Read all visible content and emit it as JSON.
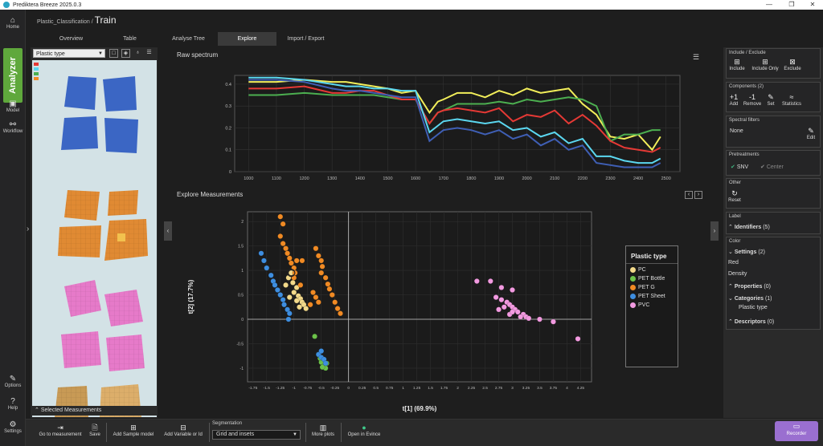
{
  "window": {
    "title": "Prediktera Breeze 2025.0.3",
    "controls": [
      "—",
      "❐",
      "✕"
    ]
  },
  "rail": {
    "home": "Home",
    "analyzer": "Analyzer",
    "model": "Model",
    "workflow": "Workflow",
    "options": "Options",
    "help": "Help",
    "settings": "Settings"
  },
  "breadcrumb": {
    "project": "Plastic_Classification /",
    "page": "Train"
  },
  "tabs": [
    "Overview",
    "Table",
    "Analyse Tree",
    "Explore",
    "Import / Export"
  ],
  "image_panel": {
    "select_value": "Plastic type",
    "selected_measurements": "Selected Measurements"
  },
  "spectrum": {
    "title": "Raw spectrum",
    "chart_data": {
      "type": "line",
      "title": "Raw spectrum",
      "xlabel": "",
      "ylabel": "",
      "xlim": [
        950,
        2550
      ],
      "ylim": [
        0,
        0.44
      ],
      "xticks": [
        1000,
        1100,
        1200,
        1300,
        1400,
        1500,
        1600,
        1700,
        1800,
        1900,
        2000,
        2100,
        2200,
        2300,
        2400,
        2500
      ],
      "yticks": [
        0,
        0.1,
        0.2,
        0.3,
        0.4
      ],
      "x": [
        1000,
        1100,
        1200,
        1300,
        1350,
        1400,
        1450,
        1500,
        1550,
        1600,
        1650,
        1680,
        1700,
        1750,
        1800,
        1850,
        1900,
        1950,
        2000,
        2050,
        2100,
        2150,
        2200,
        2250,
        2300,
        2350,
        2400,
        2450,
        2480
      ],
      "series": [
        {
          "color": "#f2ee5a",
          "values": [
            0.41,
            0.41,
            0.42,
            0.41,
            0.41,
            0.4,
            0.39,
            0.38,
            0.36,
            0.37,
            0.27,
            0.32,
            0.33,
            0.36,
            0.36,
            0.34,
            0.37,
            0.35,
            0.38,
            0.36,
            0.37,
            0.38,
            0.31,
            0.26,
            0.16,
            0.15,
            0.17,
            0.1,
            0.16
          ]
        },
        {
          "color": "#4caf50",
          "values": [
            0.35,
            0.35,
            0.36,
            0.35,
            0.35,
            0.35,
            0.35,
            0.34,
            0.33,
            0.33,
            0.22,
            0.27,
            0.28,
            0.31,
            0.31,
            0.31,
            0.32,
            0.31,
            0.33,
            0.32,
            0.33,
            0.34,
            0.33,
            0.3,
            0.14,
            0.17,
            0.17,
            0.19,
            0.19
          ]
        },
        {
          "color": "#e53935",
          "values": [
            0.38,
            0.38,
            0.39,
            0.36,
            0.36,
            0.37,
            0.37,
            0.35,
            0.33,
            0.33,
            0.22,
            0.27,
            0.28,
            0.29,
            0.28,
            0.27,
            0.29,
            0.23,
            0.26,
            0.25,
            0.28,
            0.22,
            0.26,
            0.21,
            0.14,
            0.11,
            0.1,
            0.09,
            0.11
          ]
        },
        {
          "color": "#5bd7f0",
          "values": [
            0.43,
            0.43,
            0.42,
            0.4,
            0.39,
            0.39,
            0.38,
            0.38,
            0.37,
            0.37,
            0.18,
            0.21,
            0.23,
            0.24,
            0.23,
            0.22,
            0.23,
            0.19,
            0.2,
            0.16,
            0.18,
            0.13,
            0.15,
            0.07,
            0.07,
            0.05,
            0.04,
            0.04,
            0.06
          ]
        },
        {
          "color": "#3f5fb5",
          "values": [
            0.42,
            0.42,
            0.41,
            0.38,
            0.37,
            0.37,
            0.36,
            0.35,
            0.34,
            0.34,
            0.14,
            0.17,
            0.19,
            0.2,
            0.19,
            0.17,
            0.19,
            0.15,
            0.17,
            0.12,
            0.15,
            0.1,
            0.12,
            0.04,
            0.03,
            0.02,
            0.02,
            0.02,
            0.04
          ]
        }
      ]
    }
  },
  "explore": {
    "title": "Explore Measurements",
    "chart_data": {
      "type": "scatter",
      "xlabel": "t[1] (69.9%)",
      "ylabel": "t[2] (17.7%)",
      "xlim": [
        -1.85,
        4.45
      ],
      "ylim": [
        -1.28,
        2.2
      ],
      "xticks": [
        -1.75,
        -1.5,
        -1.25,
        -1,
        -0.75,
        -0.5,
        -0.25,
        0,
        0.25,
        0.5,
        0.75,
        1,
        1.25,
        1.5,
        1.75,
        2,
        2.25,
        2.5,
        2.75,
        3,
        3.25,
        3.5,
        3.75,
        4,
        4.25
      ],
      "xticklabels": [
        "-1.75",
        "-1.5",
        "-1.25",
        "-1",
        "-0.75",
        "-0.5",
        "-0.25",
        "0",
        "0.25",
        "0.5",
        "0.75",
        "1",
        "1.25",
        "1.5",
        "1.75",
        "2",
        "2.25",
        "2.5",
        "2.75",
        "3",
        "3.25",
        "3.5",
        "3.75",
        "4",
        "4.25"
      ],
      "yticks": [
        -1,
        -0.5,
        0,
        0.5,
        1,
        1.5,
        2
      ],
      "yticklabels": [
        "-1",
        "-0.5",
        "0",
        "0.5",
        "1",
        "1.5",
        "2"
      ],
      "series": [
        {
          "name": "PC",
          "color": "#f2d98a",
          "points": [
            [
              -1.05,
              0.95
            ],
            [
              -1.1,
              0.85
            ],
            [
              -1.02,
              0.75
            ],
            [
              -0.95,
              0.65
            ],
            [
              -1.0,
              0.55
            ],
            [
              -0.92,
              0.48
            ],
            [
              -0.88,
              0.42
            ],
            [
              -0.85,
              0.35
            ],
            [
              -0.82,
              0.3
            ],
            [
              -0.9,
              0.25
            ],
            [
              -0.78,
              0.22
            ],
            [
              -1.15,
              0.7
            ],
            [
              -1.08,
              0.45
            ],
            [
              -0.95,
              0.38
            ]
          ]
        },
        {
          "name": "PET Bottle",
          "color": "#6cc24a",
          "points": [
            [
              -0.62,
              -0.35
            ],
            [
              -0.55,
              -0.72
            ],
            [
              -0.5,
              -0.88
            ],
            [
              -0.45,
              -0.95
            ],
            [
              -0.52,
              -0.8
            ],
            [
              -0.4,
              -0.9
            ],
            [
              -0.42,
              -1.0
            ],
            [
              -0.48,
              -0.98
            ]
          ]
        },
        {
          "name": "PET G",
          "color": "#f08a24",
          "points": [
            [
              -1.25,
              2.1
            ],
            [
              -1.2,
              1.95
            ],
            [
              -1.25,
              1.7
            ],
            [
              -1.2,
              1.55
            ],
            [
              -1.15,
              1.45
            ],
            [
              -1.12,
              1.35
            ],
            [
              -1.08,
              1.25
            ],
            [
              -1.05,
              1.15
            ],
            [
              -1.0,
              1.05
            ],
            [
              -0.98,
              0.95
            ],
            [
              -0.95,
              1.2
            ],
            [
              -0.85,
              1.2
            ],
            [
              -0.6,
              1.45
            ],
            [
              -0.55,
              1.3
            ],
            [
              -0.5,
              1.2
            ],
            [
              -0.48,
              1.08
            ],
            [
              -0.5,
              0.95
            ],
            [
              -0.42,
              0.85
            ],
            [
              -0.38,
              0.72
            ],
            [
              -0.35,
              0.62
            ],
            [
              -0.3,
              0.5
            ],
            [
              -0.25,
              0.35
            ],
            [
              -0.2,
              0.22
            ],
            [
              -0.15,
              0.12
            ],
            [
              -0.65,
              0.55
            ],
            [
              -0.6,
              0.45
            ],
            [
              -0.55,
              0.35
            ],
            [
              -0.7,
              0.3
            ],
            [
              -0.88,
              0.7
            ],
            [
              -1.0,
              0.85
            ]
          ]
        },
        {
          "name": "PET Sheet",
          "color": "#3e8ee0",
          "points": [
            [
              -1.6,
              1.35
            ],
            [
              -1.55,
              1.2
            ],
            [
              -1.5,
              1.05
            ],
            [
              -1.42,
              0.9
            ],
            [
              -1.38,
              0.78
            ],
            [
              -1.35,
              0.7
            ],
            [
              -1.3,
              0.6
            ],
            [
              -1.25,
              0.5
            ],
            [
              -1.2,
              0.4
            ],
            [
              -1.18,
              0.3
            ],
            [
              -1.12,
              0.2
            ],
            [
              -1.08,
              0.12
            ],
            [
              -1.1,
              0.0
            ],
            [
              -0.55,
              -0.72
            ],
            [
              -0.5,
              -0.78
            ],
            [
              -0.45,
              -0.82
            ],
            [
              -0.42,
              -0.9
            ],
            [
              -0.5,
              -0.65
            ]
          ]
        },
        {
          "name": "PVC",
          "color": "#f29ae0",
          "points": [
            [
              2.35,
              0.78
            ],
            [
              2.6,
              0.78
            ],
            [
              2.8,
              0.65
            ],
            [
              3.0,
              0.6
            ],
            [
              2.7,
              0.45
            ],
            [
              2.8,
              0.4
            ],
            [
              2.9,
              0.35
            ],
            [
              2.95,
              0.3
            ],
            [
              3.0,
              0.25
            ],
            [
              3.05,
              0.2
            ],
            [
              3.1,
              0.15
            ],
            [
              2.85,
              0.25
            ],
            [
              3.2,
              0.1
            ],
            [
              3.25,
              0.05
            ],
            [
              3.3,
              0.02
            ],
            [
              3.5,
              0.0
            ],
            [
              3.75,
              -0.05
            ],
            [
              4.2,
              -0.4
            ],
            [
              2.75,
              0.2
            ],
            [
              2.95,
              0.1
            ],
            [
              3.15,
              0.05
            ],
            [
              3.0,
              0.15
            ]
          ]
        }
      ]
    },
    "legend_title": "Plastic type"
  },
  "right": {
    "include_exclude": {
      "header": "Include / Exclude",
      "include": "Include",
      "include_only": "Include Only",
      "exclude": "Exclude"
    },
    "components": {
      "header": "Components (2)",
      "add": "Add",
      "remove": "Remove",
      "set": "Set",
      "statistics": "Statistics",
      "add_sym": "+1",
      "remove_sym": "-1"
    },
    "spectral_filters": {
      "header": "Spectral filters",
      "value": "None",
      "edit": "Edit"
    },
    "pretreatments": {
      "header": "Pretreatments",
      "snv": "SNV",
      "center": "Center"
    },
    "other": {
      "header": "Other",
      "reset": "Reset"
    },
    "label": {
      "header": "Label",
      "identifiers": "Identifiers",
      "identifiers_count": "(5)"
    },
    "color": {
      "header": "Color",
      "settings": "Settings",
      "settings_count": "(2)",
      "settings_items": [
        "Red",
        "Density"
      ],
      "properties": "Properties",
      "properties_count": "(0)",
      "categories": "Categories",
      "categories_count": "(1)",
      "categories_items": [
        "Plastic type"
      ],
      "descriptors": "Descriptors",
      "descriptors_count": "(0)"
    }
  },
  "bottom": {
    "go_to_measurement": "Go to measurement",
    "save": "Save",
    "add_sample_model": "Add Sample model",
    "add_variable": "Add Variable or Id",
    "segmentation_label": "Segmentation",
    "segmentation_value": "Grid and insets",
    "more_plots": "More plots",
    "open_in_evince": "Open in Evince",
    "recorder": "Recorder"
  },
  "colors": {
    "accent": "#5fa83c",
    "recorder": "#9a6fd0"
  }
}
